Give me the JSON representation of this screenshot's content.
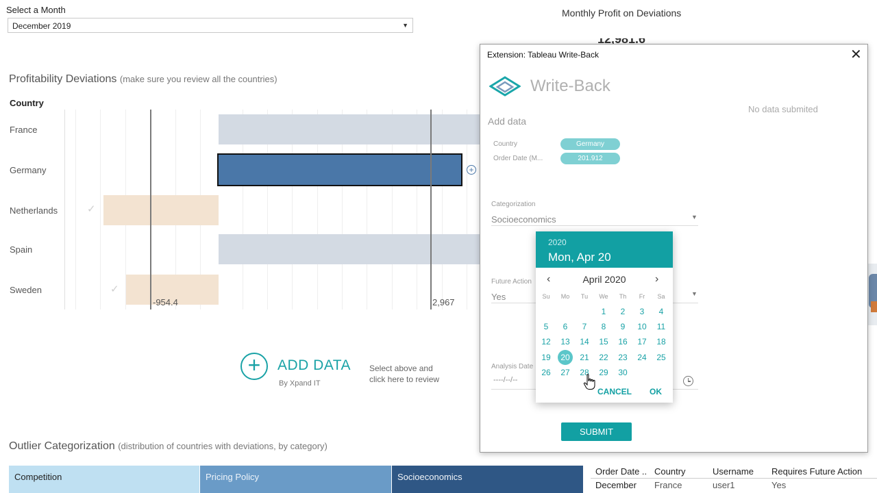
{
  "month_filter": {
    "label": "Select a Month",
    "value": "December 2019"
  },
  "dashboard_title": "Monthly Profit on Deviations",
  "kpi_partial": "12,981.6",
  "profitability": {
    "title": "Profitability Deviations",
    "subtitle": "(make sure you review all the countries)",
    "country_header": "Country",
    "countries": [
      "France",
      "Germany",
      "Netherlands",
      "Spain",
      "Sweden"
    ],
    "ref_low": "-954.4",
    "ref_high": "2,967"
  },
  "add_data": {
    "label": "ADD DATA",
    "by": "By Xpand IT",
    "hint_line1": "Select above and",
    "hint_line2": "click here to review"
  },
  "outlier": {
    "title": "Outlier Categorization",
    "subtitle": "(distribution of countries with deviations, by category)",
    "categories": [
      "Competition",
      "Pricing Policy",
      "Socioeconomics"
    ]
  },
  "table": {
    "headers": [
      "Order Date ..",
      "Country",
      "Username",
      "Requires Future Action"
    ],
    "row": [
      "December",
      "France",
      "user1",
      "Yes"
    ]
  },
  "extension": {
    "window_title": "Extension: Tableau Write-Back",
    "app_name": "Write-Back",
    "no_data": "No data submited",
    "add_data": "Add data",
    "country_label": "Country",
    "country_value": "Germany",
    "order_date_label": "Order Date (M...",
    "order_date_value": "201.912",
    "categorization_label": "Categorization",
    "categorization_value": "Socioeconomics",
    "future_action_label": "Future Action",
    "future_action_value": "Yes",
    "analysis_date_label": "Analysis Date",
    "analysis_date_placeholder": "----/--/--",
    "submit": "SUBMIT"
  },
  "date_picker": {
    "year": "2020",
    "selected_long": "Mon, Apr 20",
    "month_title": "April 2020",
    "weekdays": [
      "Su",
      "Mo",
      "Tu",
      "We",
      "Th",
      "Fr",
      "Sa"
    ],
    "weeks": [
      [
        "",
        "",
        "",
        "1",
        "2",
        "3",
        "4"
      ],
      [
        "5",
        "6",
        "7",
        "8",
        "9",
        "10",
        "11"
      ],
      [
        "12",
        "13",
        "14",
        "15",
        "16",
        "17",
        "18"
      ],
      [
        "19",
        "20",
        "21",
        "22",
        "23",
        "24",
        "25"
      ],
      [
        "26",
        "27",
        "28",
        "29",
        "30",
        "",
        ""
      ]
    ],
    "selected_day": "20",
    "cancel": "CANCEL",
    "ok": "OK"
  },
  "colors": {
    "accent": "#12a0a3",
    "bar_selected": "#4a77a8",
    "bar_neutral": "#d3dae3",
    "bar_negative": "#f3e3d1"
  }
}
